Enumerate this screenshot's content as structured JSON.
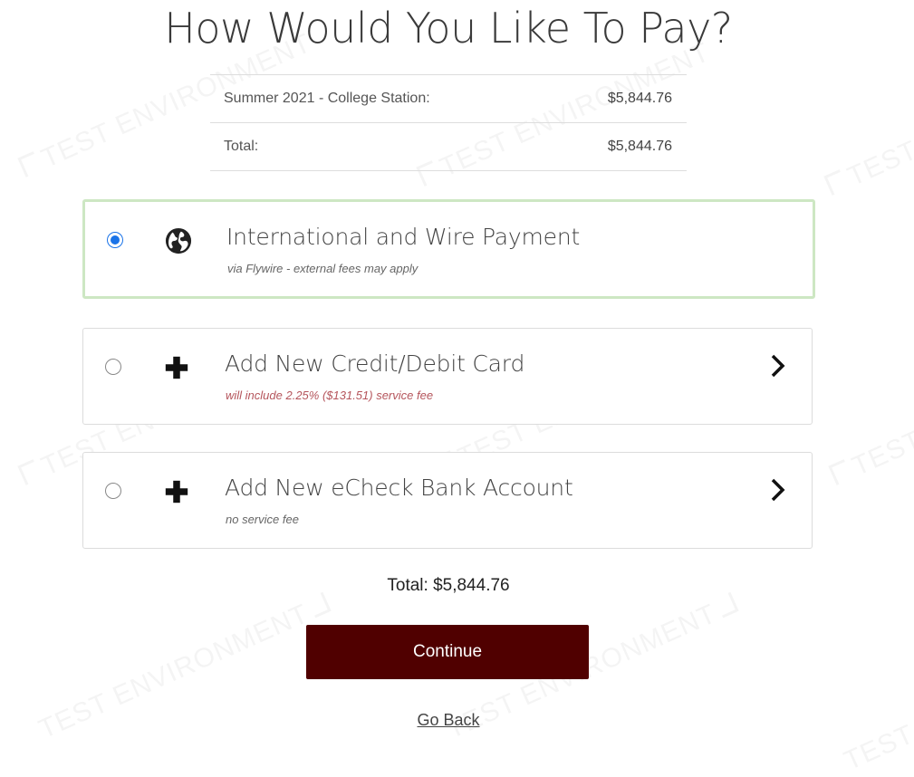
{
  "page": {
    "title": "How Would You Like To Pay?",
    "watermark_text": "TEST ENVIRONMENT"
  },
  "summary": {
    "rows": [
      {
        "label": "Summer 2021 - College Station:",
        "amount": "$5,844.76"
      },
      {
        "label": "Total:",
        "amount": "$5,844.76"
      }
    ]
  },
  "options": [
    {
      "title": "International and Wire Payment",
      "subtitle": "via Flywire - external fees may apply",
      "icon": "globe-icon",
      "selected": true
    },
    {
      "title": "Add New Credit/Debit Card",
      "subtitle": "will include 2.25% ($131.51) service fee",
      "icon": "plus-icon",
      "selected": false
    },
    {
      "title": "Add New eCheck Bank Account",
      "subtitle": "no service fee",
      "icon": "plus-icon",
      "selected": false
    }
  ],
  "footer": {
    "total_label": "Total: $5,844.76",
    "continue_label": "Continue",
    "go_back_label": "Go Back"
  },
  "colors": {
    "primary_button": "#500000",
    "selected_border": "#cde7c3",
    "radio_checked": "#1a73e8",
    "fee_text": "#b5555c"
  }
}
